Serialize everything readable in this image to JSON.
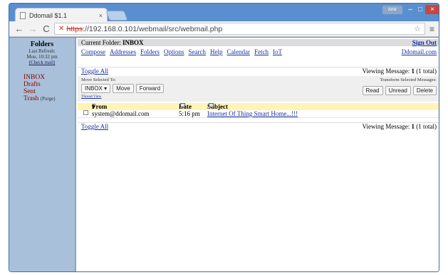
{
  "browser": {
    "tab_title": "Ddomail $1.1",
    "tab_close": "×",
    "user_badge": "Amir",
    "window_controls": {
      "minimize": "–",
      "maximize": "□",
      "close": "×"
    },
    "url_scheme": "https",
    "url_rest": "://192.168.0.101/webmail/src/webmail.php"
  },
  "left_pane": {
    "title": "Folders",
    "last_refresh_label": "Last Refresh:",
    "last_refresh_value": "Mon, 10:32 pm",
    "check_mail": "(Check mail)",
    "folders": [
      {
        "label": "INBOX"
      },
      {
        "label": "Drafts"
      },
      {
        "label": "Sent"
      },
      {
        "label": "Trash",
        "extra": "(Purge)"
      }
    ]
  },
  "header": {
    "current_folder_label": "Current Folder:",
    "current_folder": "INBOX",
    "sign_out": "Sign Out",
    "menu": [
      "Compose",
      "Addresses",
      "Folders",
      "Options",
      "Search",
      "Help",
      "Calendar",
      "Fetch",
      "IoT"
    ],
    "site_link": "Ddomail.com"
  },
  "listing": {
    "toggle_all": "Toggle All",
    "viewing_prefix": "Viewing Message:",
    "viewing_count": "1",
    "viewing_suffix": "(1 total)",
    "move_selected_label": "Move Selected To:",
    "move_target": "INBOX ▾",
    "move_button": "Move",
    "forward_button": "Forward",
    "thread_view": "Thread View",
    "transform_label": "Transform Selected Messages:",
    "read_button": "Read",
    "unread_button": "Unread",
    "delete_button": "Delete",
    "columns": {
      "from": "From",
      "date": "Date",
      "subject": "Subject"
    },
    "messages": [
      {
        "from": "system@ddomail.com",
        "date": "5:16 pm",
        "subject": "Internet Of Thing Smart Home...!!!"
      }
    ]
  }
}
